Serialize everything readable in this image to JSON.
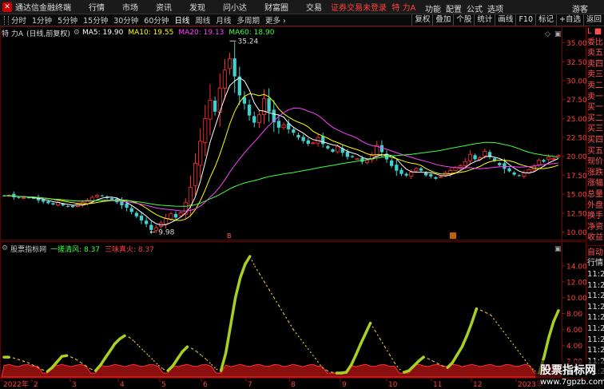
{
  "menubar": {
    "app_title": "通达信金融终端",
    "menus": [
      "行情",
      "市场",
      "资讯",
      "发现",
      "问小达",
      "财富圈",
      "交易"
    ],
    "warning": "证券交易未登录",
    "stock_tag": "特 力A",
    "right_items": [
      "功能",
      "配置",
      "公式",
      "选项"
    ],
    "guest": "游客"
  },
  "periodbar": {
    "periods": [
      "分时",
      "1分钟",
      "5分钟",
      "15分钟",
      "30分钟",
      "60分钟",
      "日线",
      "周线",
      "月线",
      "多周期",
      "更多"
    ],
    "active": "日线",
    "tools": [
      "复权",
      "叠加",
      "个股",
      "统计",
      "画线",
      "F10",
      "标记",
      "+自选",
      "返回"
    ]
  },
  "main_title": {
    "stock": "特 力A",
    "mode": "(日线,前复权)",
    "ma": [
      {
        "label": "MA5: 19.90",
        "color": "#ffffff"
      },
      {
        "label": "MA10: 19.55",
        "color": "#ffff00"
      },
      {
        "label": "MA20: 19.13",
        "color": "#ff40ff"
      },
      {
        "label": "MA60: 18.90",
        "color": "#40ff40"
      }
    ]
  },
  "sub_title": {
    "name": "股票指标网",
    "items": [
      {
        "label": "一搓清风: 8.37",
        "color": "#40ff40"
      },
      {
        "label": "三味真火: 8.37",
        "color": "#ff4040"
      }
    ]
  },
  "annotations": {
    "high": "35.24",
    "low": "9.98",
    "time_mark_main": "B"
  },
  "chart_data": [
    {
      "type": "candlestick",
      "title": "特 力A (日线,前复权)",
      "yaxis_ticks": [
        "35.00",
        "32.50",
        "30.00",
        "27.50",
        "25.00",
        "22.50",
        "20.00",
        "17.50",
        "15.00",
        "12.50",
        "10.00"
      ],
      "ylim": [
        9,
        35.8
      ],
      "high": 35.24,
      "low": 9.98,
      "close_path": [
        14.8,
        14.9,
        14.7,
        14.6,
        14.5,
        14.6,
        14.4,
        14.3,
        14.1,
        13.9,
        13.6,
        13.8,
        13.5,
        13.3,
        13.4,
        13.6,
        13.9,
        14.2,
        14.6,
        14.9,
        14.7,
        14.5,
        14.3,
        14.0,
        13.6,
        13.1,
        12.6,
        12.2,
        11.6,
        11.0,
        10.4,
        10.6,
        11.2,
        11.8,
        12.3,
        12.0,
        12.5,
        13.8,
        16.0,
        19.0,
        22.0,
        25.0,
        27.5,
        26.0,
        29.0,
        31.5,
        33.0,
        30.5,
        28.0,
        27.0,
        25.5,
        24.5,
        25.5,
        27.5,
        26.0,
        24.5,
        23.8,
        24.2,
        23.5,
        23.0,
        22.5,
        22.0,
        21.6,
        21.8,
        22.6,
        21.5,
        21.0,
        20.6,
        21.2,
        20.5,
        20.0,
        19.8,
        19.6,
        19.3,
        19.6,
        20.2,
        21.5,
        20.5,
        19.5,
        18.8,
        18.2,
        17.8,
        17.5,
        17.9,
        18.3,
        18.0,
        17.6,
        17.3,
        17.1,
        17.4,
        17.8,
        18.1,
        18.4,
        18.8,
        19.4,
        20.2,
        19.6,
        19.9,
        20.6,
        19.8,
        19.3,
        18.9,
        18.4,
        18.0,
        17.6,
        17.5,
        17.8,
        18.2,
        18.8,
        19.6,
        19.4,
        19.9,
        19.8,
        20.0
      ],
      "series": [
        {
          "name": "MA5",
          "value": 19.9,
          "color": "#ffffff"
        },
        {
          "name": "MA10",
          "value": 19.55,
          "color": "#ffff00"
        },
        {
          "name": "MA20",
          "value": 19.13,
          "color": "#ff40ff"
        },
        {
          "name": "MA60",
          "value": 18.9,
          "color": "#40ff40"
        }
      ]
    },
    {
      "type": "area",
      "title": "股票指标网",
      "yaxis_ticks": [
        "14.00",
        "12.00",
        "10.00",
        "8.00",
        "6.00",
        "4.00",
        "2.00"
      ],
      "ylim": [
        0,
        15.5
      ],
      "xaxis_ticks": [
        "2022年",
        "2",
        "3",
        "4",
        "5",
        "6",
        "7",
        "8",
        "9",
        "10",
        "11",
        "12",
        "2023年"
      ],
      "series": [
        {
          "name": "一搓清风",
          "value": 8.37,
          "color": "#a8d020"
        },
        {
          "name": "三味真火",
          "value": 8.37,
          "color": "#ff4040"
        }
      ],
      "yellow_path": [
        2.5,
        2.5,
        2.4,
        2.2,
        2.0,
        1.8,
        1.5,
        1.2,
        0.9,
        0.7,
        1.2,
        1.9,
        2.6,
        2.7,
        2.5,
        2.2,
        1.8,
        1.4,
        1.0,
        0.8,
        1.5,
        2.4,
        3.3,
        4.2,
        4.8,
        5.2,
        5.0,
        4.5,
        3.9,
        3.3,
        2.7,
        2.1,
        1.5,
        1.0,
        0.8,
        1.4,
        2.3,
        3.2,
        3.8,
        3.6,
        3.2,
        2.7,
        2.2,
        1.6,
        1.0,
        0.8,
        3.0,
        6.5,
        10.0,
        12.5,
        14.2,
        15.2,
        14.0,
        13.0,
        12.0,
        11.0,
        10.0,
        9.0,
        8.0,
        7.0,
        6.0,
        5.2,
        4.4,
        3.6,
        2.8,
        2.0,
        1.2,
        0.8,
        0.6,
        0.5,
        0.5,
        0.6,
        1.5,
        2.8,
        4.2,
        5.5,
        6.8,
        5.8,
        4.8,
        3.8,
        2.8,
        1.8,
        1.0,
        0.6,
        0.8,
        1.4,
        2.0,
        2.5,
        2.3,
        2.0,
        1.7,
        1.4,
        1.2,
        1.8,
        2.8,
        3.8,
        5.2,
        6.8,
        8.6,
        8.4,
        8.1,
        7.8,
        7.0,
        6.2,
        5.4,
        4.6,
        3.8,
        3.0,
        2.2,
        1.4,
        0.8,
        0.5,
        2.5,
        5.0,
        7.0,
        8.37
      ]
    }
  ]
}
